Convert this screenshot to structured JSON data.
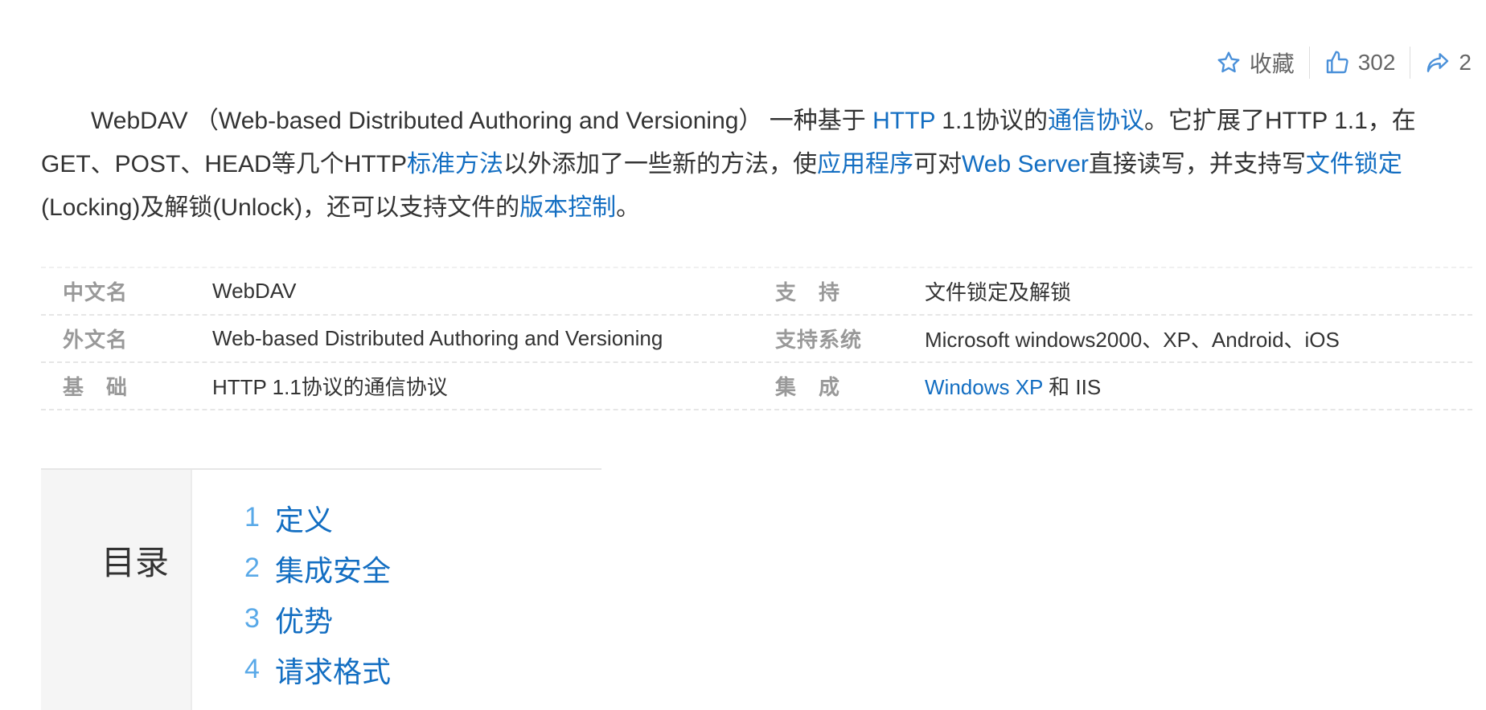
{
  "actions": {
    "favorite_label": "收藏",
    "like_count": "302",
    "share_count": "2"
  },
  "summary": {
    "p1": "WebDAV （Web-based Distributed Authoring and Versioning） 一种基于 ",
    "link_http": "HTTP",
    "p2": " 1.1协议的",
    "link_protocol": "通信协议",
    "p3": "。它扩展了HTTP 1.1，在GET、POST、HEAD等几个HTTP",
    "link_std_method": "标准方法",
    "p4": "以外添加了一些新的方法，使",
    "link_app": "应用程序",
    "p5": "可对",
    "link_webserver": "Web Server",
    "p6": "直接读写，并支持写",
    "link_lock": "文件锁定",
    "p7": "(Locking)及解锁(Unlock)，还可以支持文件的",
    "link_version": "版本控制",
    "p8": "。"
  },
  "basic_info": {
    "rows": [
      {
        "name1": "中文名",
        "value1": "WebDAV",
        "name2": "支　持",
        "value2": "文件锁定及解锁"
      },
      {
        "name1": "外文名",
        "value1": "Web-based Distributed Authoring and Versioning",
        "name2": "支持系统",
        "value2": "Microsoft windows2000、XP、Android、iOS"
      },
      {
        "name1": "基　础",
        "value1": "HTTP 1.1协议的通信协议",
        "name2": "集　成",
        "value2_link": "Windows XP",
        "value2_rest": " 和 IIS"
      }
    ]
  },
  "catalog": {
    "title": "目录",
    "items": [
      {
        "index": "1",
        "label": "定义"
      },
      {
        "index": "2",
        "label": "集成安全"
      },
      {
        "index": "3",
        "label": "优势"
      },
      {
        "index": "4",
        "label": "请求格式"
      }
    ]
  },
  "colors": {
    "link": "#136ec2",
    "catalog_index": "#59a9e8",
    "muted": "#999999"
  }
}
